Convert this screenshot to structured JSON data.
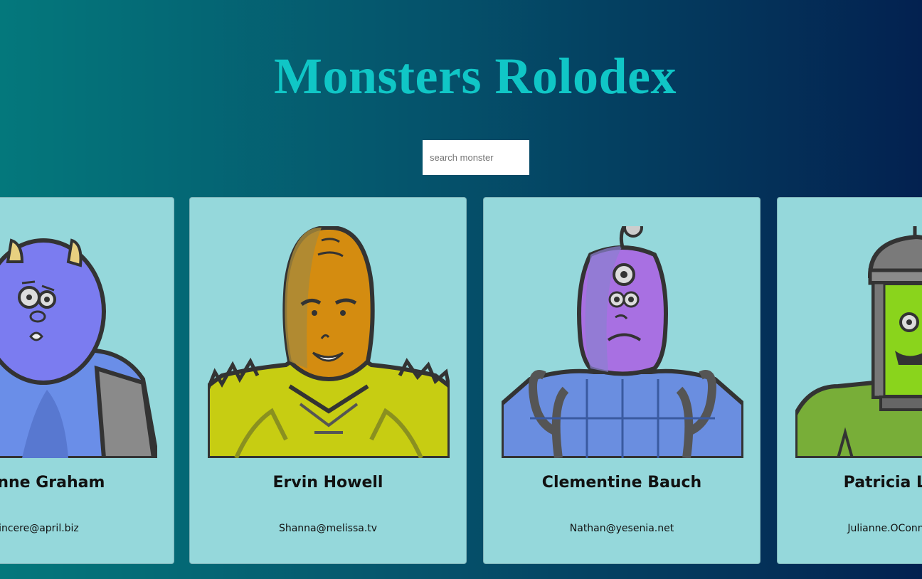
{
  "header": {
    "title": "Monsters Rolodex"
  },
  "search": {
    "placeholder": "search monster",
    "value": ""
  },
  "monsters": [
    {
      "name": "Leanne Graham",
      "email": "Sincere@april.biz",
      "skin": "#6f8cf0",
      "body": "#6a8ee8"
    },
    {
      "name": "Ervin Howell",
      "email": "Shanna@melissa.tv",
      "skin": "#d08a12",
      "body": "#c8cc10"
    },
    {
      "name": "Clementine Bauch",
      "email": "Nathan@yesenia.net",
      "skin": "#a46fe0",
      "body": "#6a8ee0"
    },
    {
      "name": "Patricia Lebsack",
      "email": "Julianne.OConner@kory.org",
      "skin": "#8ad41c",
      "body": "#7ab034"
    }
  ]
}
